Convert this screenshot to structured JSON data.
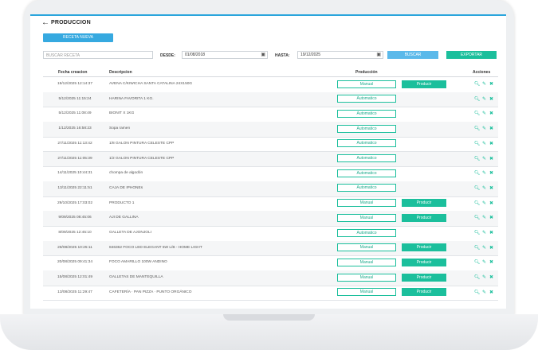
{
  "page": {
    "title": "PRODUCCION"
  },
  "toolbar": {
    "new_label": "RECETA NUEVA",
    "search_placeholder": "BUSCAR RECETA",
    "from_label": "DESDE:",
    "from_value": "01/08/2018",
    "to_label": "HASTA:",
    "to_value": "19/12/2025",
    "search_btn": "BUSCAR",
    "export_btn": "EXPORTAR"
  },
  "table": {
    "headers": {
      "date": "Fecha creacion",
      "desc": "Descripcion",
      "prod": "Producción",
      "actions": "Acciones"
    },
    "produce_label": "Producir",
    "rows": [
      {
        "date": "19/12/2025 12:14:37",
        "desc": "AVENA C/KIWICHA SANTA CATALINA 24X150G",
        "mode": "Manual"
      },
      {
        "date": "5/12/2025 11:15:24",
        "desc": "HARINA FAVORITA 1 KG.",
        "mode": "Automatico"
      },
      {
        "date": "5/12/2025 11:08:49",
        "desc": "BIONIT X 1KG",
        "mode": "Automatico"
      },
      {
        "date": "1/12/2025 16:58:23",
        "desc": "Sopa ramen",
        "mode": "Automatico"
      },
      {
        "date": "27/11/2025 11:13:42",
        "desc": "1/8 GALON PINTURA CELESTE CPP",
        "mode": "Automatico"
      },
      {
        "date": "27/11/2025 11:05:39",
        "desc": "1/2 GALON PINTURA CELESTE CPP",
        "mode": "Automatico"
      },
      {
        "date": "14/11/2025 10:44:31",
        "desc": "chompa de algodón",
        "mode": "Automatico"
      },
      {
        "date": "13/11/2025 22:11:51",
        "desc": "CAJA DE IPHONEs",
        "mode": "Automatico"
      },
      {
        "date": "29/10/2025 17:03:02",
        "desc": "PRODUCTO 1",
        "mode": "Manual"
      },
      {
        "date": "9/09/2025 08:45:06",
        "desc": "AJI DE GALLINA",
        "mode": "Manual"
      },
      {
        "date": "8/09/2025 12:45:10",
        "desc": "GALLETA DE AJONJOLI",
        "mode": "Automatico"
      },
      {
        "date": "28/08/2025 10:25:11",
        "desc": "846362 FOCO LED ELEGANT 5W L/B - HOME LIGHT",
        "mode": "Manual"
      },
      {
        "date": "20/08/2025 09:41:34",
        "desc": "FOCO AMARILLO 100W ANDINO",
        "mode": "Manual"
      },
      {
        "date": "15/08/2025 12:01:49",
        "desc": "GALLETAS DE MANTEQUILLA",
        "mode": "Manual"
      },
      {
        "date": "13/08/2025 11:29:47",
        "desc": "CAFETERÍA · PAN PIZZA · PUNTO ORGÁNICO",
        "mode": "Manual"
      }
    ]
  },
  "icons": {
    "back": "arrow-left-icon",
    "calendar": "calendar-icon",
    "view": "search-icon",
    "edit": "pencil-icon",
    "delete": "close-icon"
  },
  "colors": {
    "accent": "#1bbf9c",
    "primary": "#36a9e0"
  }
}
